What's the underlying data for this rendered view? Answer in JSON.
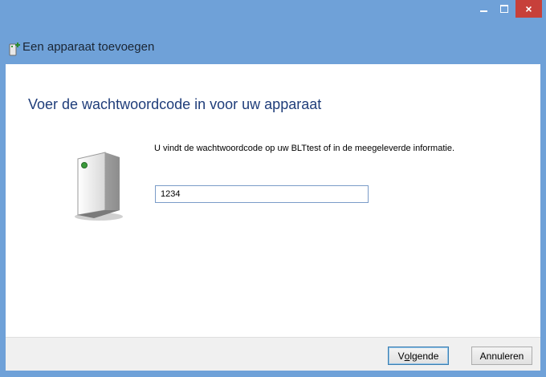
{
  "window": {
    "controls": {
      "minimize": "minimize-icon",
      "maximize": "maximize-icon",
      "close": "×"
    }
  },
  "header": {
    "title": "Een apparaat toevoegen",
    "icon": "add-device-icon"
  },
  "main": {
    "title": "Voer de wachtwoordcode in voor uw apparaat",
    "device_icon": "device-tower-icon",
    "instruction": "U vindt de wachtwoordcode op uw BLTtest of in de meegeleverde informatie.",
    "code_value": "1234"
  },
  "footer": {
    "next_prefix": "V",
    "next_accesskey": "o",
    "next_suffix": "lgende",
    "cancel_label": "Annuleren"
  },
  "colors": {
    "titlebar": "#6fa1d8",
    "close_button": "#c7403a",
    "title_text": "#1f3d7a"
  }
}
